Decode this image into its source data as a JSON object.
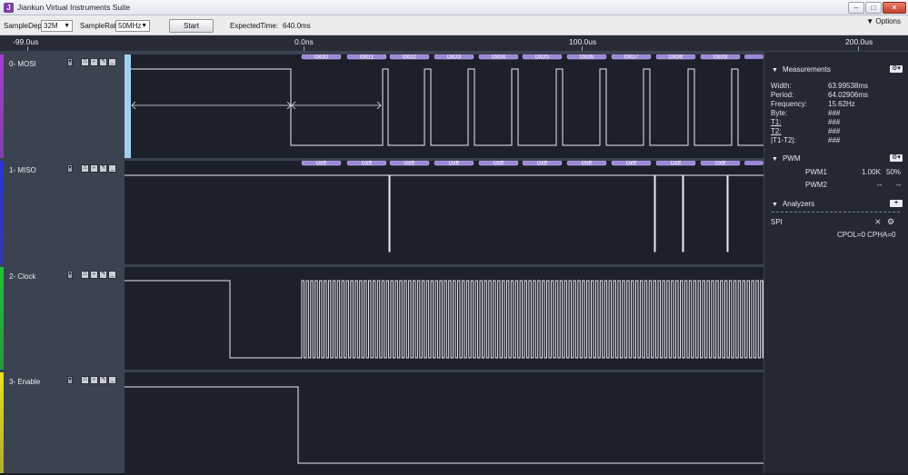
{
  "app": {
    "title": "Jiankun Virtual Instruments Suite",
    "icon": "app-logo-icon"
  },
  "window": {
    "minimize": "–",
    "maximize": "□",
    "close": "✕"
  },
  "toolbar": {
    "sample_depth_label": "SampleDepth",
    "sample_depth_value": "32M",
    "sample_rate_label": "SampleRate",
    "sample_rate_value": "50MHz",
    "start_label": "Start",
    "expected_time_label": "ExpectedTime:",
    "expected_time_value": "640.0ms",
    "options_label": "Options"
  },
  "ruler": {
    "ticks": [
      "-99.0us",
      "0.0ns",
      "100.0us",
      "200.0us"
    ]
  },
  "channels": [
    {
      "label": "0- MOSI",
      "color": "#a33fd0",
      "decode": [
        "0x00",
        "0x01",
        "0x02",
        "0x03",
        "0x04",
        "0x05",
        "0x06",
        "0x07",
        "0x08",
        "0x09"
      ]
    },
    {
      "label": "1- MISO",
      "color": "#2d34d6",
      "decode": [
        "0xff",
        "0xff",
        "0xff",
        "0xff",
        "0xff",
        "0xff",
        "0xff",
        "0xff",
        "0xff",
        "0xff"
      ]
    },
    {
      "label": "2- Clock",
      "color": "#1fc23a"
    },
    {
      "label": "3- Enable",
      "color": "#e9e020"
    }
  ],
  "measurements": {
    "title": "Measurements",
    "rows": [
      {
        "label": "Width:",
        "value": "63.99538ms"
      },
      {
        "label": "Period:",
        "value": "64.02906ms"
      },
      {
        "label": "Frequency:",
        "value": "15.62Hz"
      },
      {
        "label": "Byte:",
        "value": "###"
      },
      {
        "label": "T1:",
        "value": "###"
      },
      {
        "label": "T2:",
        "value": "###"
      },
      {
        "label": "|T1-T2|:",
        "value": "###"
      }
    ]
  },
  "pwm": {
    "title": "PWM",
    "rows": [
      {
        "name": "PWM1",
        "freq": "1.00K",
        "duty": "50%"
      },
      {
        "name": "PWM2",
        "freq": "--",
        "duty": "--"
      }
    ]
  },
  "analyzers": {
    "title": "Analyzers",
    "add": "+",
    "spi_label": "SPI",
    "spi_config": "CPOL=0 CPHA=0"
  }
}
